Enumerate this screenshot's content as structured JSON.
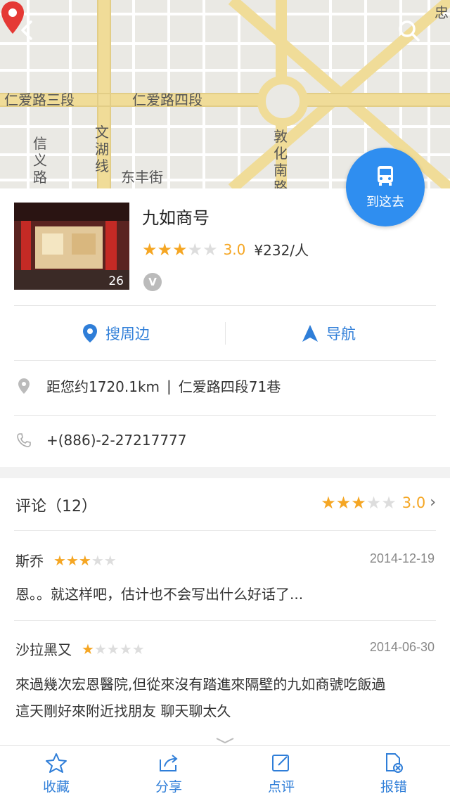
{
  "map": {
    "roads": [
      "仁爱路三段",
      "仁爱路四段",
      "信义路三",
      "文湖线",
      "东丰街",
      "敦化南路",
      "忠"
    ],
    "pin_color": "#e53935"
  },
  "go_button": {
    "label": "到这去",
    "icon": "bus-icon",
    "color": "#2f8ef0"
  },
  "poi": {
    "name": "九如商号",
    "photo_count": "26",
    "rating": 3.0,
    "rating_text": "3.0",
    "price": "¥232/人",
    "verified_badge": "V"
  },
  "actions": [
    {
      "label": "搜周边",
      "icon": "location-pin-icon"
    },
    {
      "label": "导航",
      "icon": "navigation-arrow-icon"
    }
  ],
  "info": {
    "distance": "距您约1720.1km",
    "address": "仁爱路四段71巷",
    "phone": "+(886)-2-27217777"
  },
  "reviews": {
    "header": "评论（12）",
    "rating": 3.0,
    "rating_text": "3.0",
    "items": [
      {
        "author": "斯乔",
        "stars": 3,
        "date": "2014-12-19",
        "text": "恩。。就这样吧，估计也不会写出什么好话了..."
      },
      {
        "author": "沙拉黑又",
        "stars": 1,
        "date": "2014-06-30",
        "text_line1": "來過幾次宏恩醫院,但從來沒有踏進來隔壁的九如商號吃飯過",
        "text_line2": "這天剛好來附近找朋友  聊天聊太久"
      }
    ]
  },
  "bottom_tabs": [
    {
      "label": "收藏",
      "icon": "star-outline-icon"
    },
    {
      "label": "分享",
      "icon": "share-icon"
    },
    {
      "label": "点评",
      "icon": "edit-icon"
    },
    {
      "label": "报错",
      "icon": "report-error-icon"
    }
  ],
  "colors": {
    "accent": "#2f7ed8",
    "star": "#f5a623",
    "star_off": "#dddddd"
  }
}
